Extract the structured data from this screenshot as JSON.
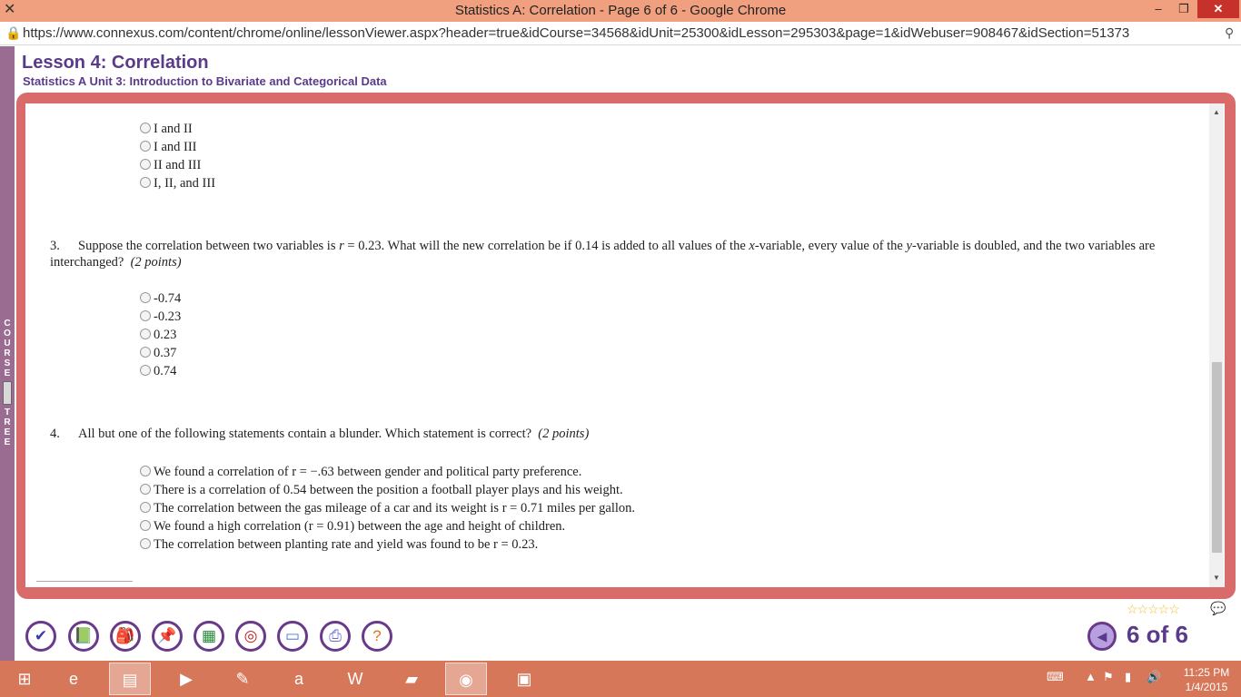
{
  "window": {
    "title": "Statistics A: Correlation - Page 6 of 6 - Google Chrome",
    "minimize": "–",
    "maximize": "❐",
    "close": "✕"
  },
  "address": {
    "url": "https://www.connexus.com/content/chrome/online/lessonViewer.aspx?header=true&idCourse=34568&idUnit=25300&idLesson=295303&page=1&idWebuser=908467&idSection=51373"
  },
  "sidebar": {
    "course_tree_top": [
      "C",
      "O",
      "U",
      "R",
      "S",
      "E"
    ],
    "course_tree_bottom": [
      "T",
      "R",
      "E",
      "E"
    ]
  },
  "lesson": {
    "title": "Lesson 4: Correlation",
    "subtitle": "Statistics A  Unit 3: Introduction to Bivariate and Categorical Data"
  },
  "question2": {
    "options": [
      "I and II",
      "I and III",
      "II and III",
      "I, II, and III"
    ]
  },
  "question3": {
    "number": "3.",
    "text_a": "Suppose the correlation between two variables is ",
    "r_symbol": "r",
    "text_b": " = 0.23. What will the new correlation be if 0.14 is added to all values of the ",
    "x_symbol": "x",
    "text_c": "-variable, every value of the ",
    "y_symbol": "y",
    "text_d": "-variable is doubled, and the two variables are interchanged?",
    "points": "(2 points)",
    "options": [
      "-0.74",
      "-0.23",
      "0.23",
      "0.37",
      "0.74"
    ]
  },
  "question4": {
    "number": "4.",
    "text": "All but one of the following statements contain a blunder. Which statement is correct?",
    "points": "(2 points)",
    "options": [
      "We found a correlation of r = −.63 between gender and political party preference.",
      "There is a correlation of 0.54 between the position a football player plays and his weight.",
      "The correlation between the gas mileage of a car and its weight is r = 0.71 miles per gallon.",
      "We found a high correlation (r = 0.91) between the age and height of children.",
      "The correlation between planting rate and yield was found to be r = 0.23."
    ]
  },
  "footer": {
    "stars": "☆☆☆☆☆",
    "page_indicator": "6 of 6"
  },
  "taskbar": {
    "time": "11:25 PM",
    "date": "1/4/2015"
  },
  "icons": {
    "app": "connexus-icon",
    "lock": "lock-icon",
    "pin": "pin-icon"
  }
}
